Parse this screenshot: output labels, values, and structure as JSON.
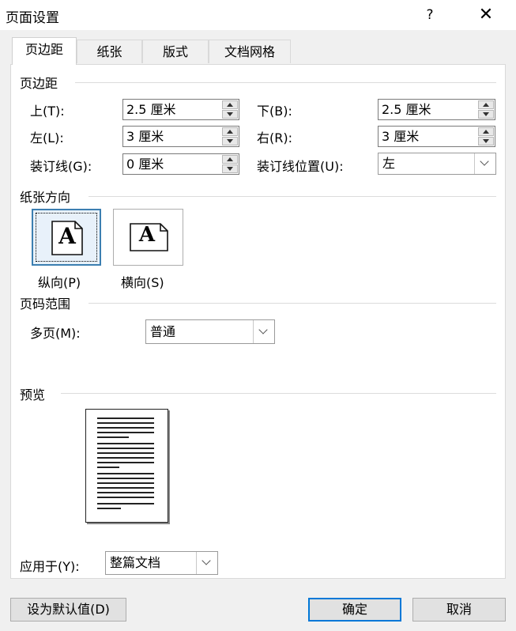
{
  "window": {
    "title": "页面设置",
    "help": "?",
    "close": "✕"
  },
  "tabs": [
    {
      "label": "页边距",
      "active": true
    },
    {
      "label": "纸张",
      "active": false
    },
    {
      "label": "版式",
      "active": false
    },
    {
      "label": "文档网格",
      "active": false
    }
  ],
  "margins": {
    "section": "页边距",
    "top": {
      "label": "上(T):",
      "value": "2.5 厘米"
    },
    "bottom": {
      "label": "下(B):",
      "value": "2.5 厘米"
    },
    "left": {
      "label": "左(L):",
      "value": "3 厘米"
    },
    "right": {
      "label": "右(R):",
      "value": "3 厘米"
    },
    "gutter": {
      "label": "装订线(G):",
      "value": "0 厘米"
    },
    "gutter_position": {
      "label": "装订线位置(U):",
      "value": "左"
    }
  },
  "orientation": {
    "section": "纸张方向",
    "portrait": "纵向(P)",
    "landscape": "横向(S)",
    "glyph": "A",
    "selected": "portrait"
  },
  "pages": {
    "section": "页码范围",
    "multiple_label": "多页(M):",
    "multiple_value": "普通"
  },
  "preview": {
    "section": "预览"
  },
  "apply": {
    "label": "应用于(Y):",
    "value": "整篇文档"
  },
  "buttons": {
    "default": "设为默认值(D)",
    "ok": "确定",
    "cancel": "取消"
  },
  "colors": {
    "accent": "#0078d7",
    "selected_border": "#3c7fb1"
  }
}
